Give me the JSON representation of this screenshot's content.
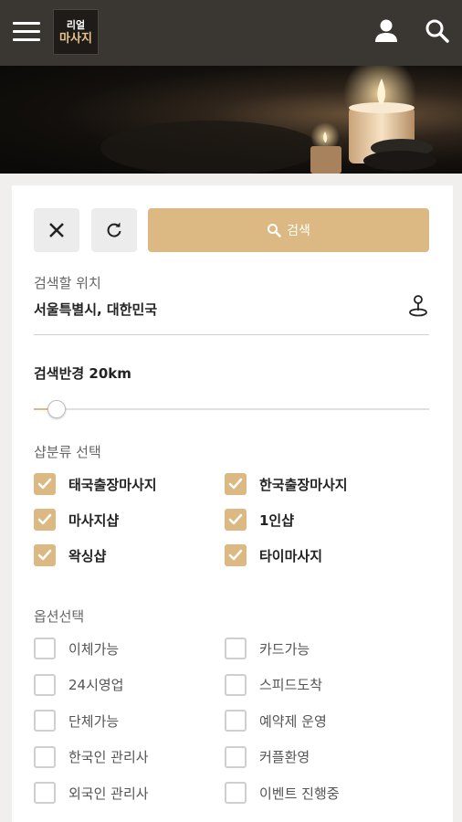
{
  "header": {
    "logo_line1": "리얼",
    "logo_line2": "마사지"
  },
  "search_bar": {
    "search_label": "검색"
  },
  "location": {
    "label": "검색할 위치",
    "value": "서울특별시, 대한민국"
  },
  "radius": {
    "label": "검색반경 20km",
    "value_fraction": 0.04
  },
  "shop_category": {
    "label": "샵분류 선택",
    "items": [
      {
        "label": "태국출장마사지",
        "checked": true
      },
      {
        "label": "한국출장마사지",
        "checked": true
      },
      {
        "label": "마사지샵",
        "checked": true
      },
      {
        "label": "1인샵",
        "checked": true
      },
      {
        "label": "왁싱샵",
        "checked": true
      },
      {
        "label": "타이마사지",
        "checked": true
      }
    ]
  },
  "options": {
    "label": "옵션선택",
    "items": [
      {
        "label": "이체가능",
        "checked": false
      },
      {
        "label": "카드가능",
        "checked": false
      },
      {
        "label": "24시영업",
        "checked": false
      },
      {
        "label": "스피드도착",
        "checked": false
      },
      {
        "label": "단체가능",
        "checked": false
      },
      {
        "label": "예약제 운영",
        "checked": false
      },
      {
        "label": "한국인 관리사",
        "checked": false
      },
      {
        "label": "커플환영",
        "checked": false
      },
      {
        "label": "외국인 관리사",
        "checked": false
      },
      {
        "label": "이벤트 진행중",
        "checked": false
      }
    ]
  },
  "colors": {
    "accent": "#dcb883",
    "header_bg": "#3a3632"
  }
}
